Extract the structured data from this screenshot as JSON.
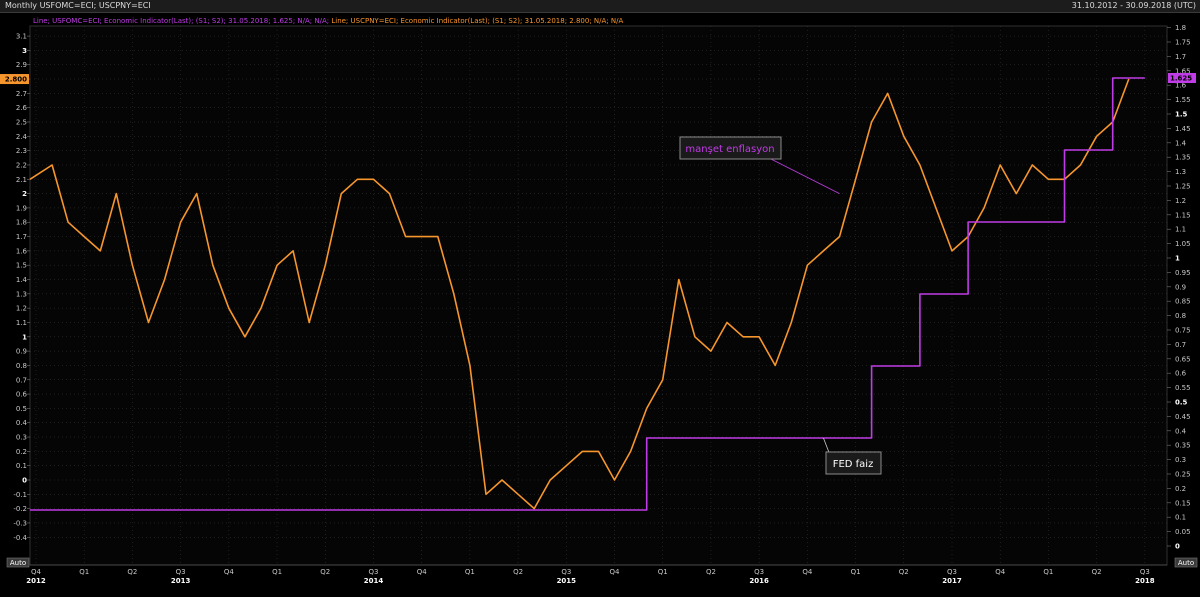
{
  "header": {
    "title": "Monthly USFOMC=ECI; USCPNY=ECI",
    "range": "31.10.2012 - 30.09.2018 (UTC)"
  },
  "legend": {
    "fed_text": "Line; USFOMC=ECI; Economic Indicator(Last); (S1; S2); 31.05.2018; 1.625; N/A; N/A",
    "cpi_text": "Line; USCPNY=ECI; Economic Indicator(Last); (S1; S2); 31.05.2018; 2.800; N/A; N/A"
  },
  "controls": {
    "auto_left": "Auto",
    "auto_right": "Auto"
  },
  "colors": {
    "background": "#000000",
    "cpi": "#f7962d",
    "fed": "#c03ce6",
    "grid": "#3a3a3a"
  },
  "chart_data": {
    "type": "line",
    "x_start": "2012-10",
    "x_end": "2018-09",
    "frequency": "monthly",
    "left_axis": {
      "ylim": [
        -0.5,
        3.2
      ],
      "ticks": [
        -0.4,
        -0.3,
        -0.2,
        -0.1,
        0,
        0.1,
        0.2,
        0.3,
        0.4,
        0.5,
        0.6,
        0.7,
        0.8,
        0.9,
        1,
        1.1,
        1.2,
        1.3,
        1.4,
        1.5,
        1.6,
        1.7,
        1.8,
        1.9,
        2,
        2.1,
        2.2,
        2.3,
        2.4,
        2.5,
        2.6,
        2.7,
        2.8,
        2.9,
        3,
        3.1
      ],
      "tick_labels": [
        "-0.4",
        "-0.3",
        "-0.2",
        "-0.1",
        "0",
        "0.1",
        "0.2",
        "0.3",
        "0.4",
        "0.5",
        "0.6",
        "0.7",
        "0.8",
        "0.9",
        "1",
        "1.1",
        "1.2",
        "1.3",
        "1.4",
        "1.5",
        "1.6",
        "1.7",
        "1.8",
        "1.9",
        "2",
        "2.1",
        "2.2",
        "2.3",
        "2.4",
        "2.5",
        "2.6",
        "2.7",
        "2.8",
        "2.9",
        "3",
        "3.1"
      ],
      "bold_labels": [
        "0",
        "1",
        "2",
        "3"
      ]
    },
    "right_axis": {
      "ylim": [
        -0.05,
        1.85
      ],
      "ticks": [
        0,
        0.05,
        0.1,
        0.15,
        0.2,
        0.25,
        0.3,
        0.35,
        0.4,
        0.45,
        0.5,
        0.55,
        0.6,
        0.65,
        0.7,
        0.75,
        0.8,
        0.85,
        0.9,
        0.95,
        1,
        1.05,
        1.1,
        1.15,
        1.2,
        1.25,
        1.3,
        1.35,
        1.4,
        1.45,
        1.5,
        1.55,
        1.6,
        1.65,
        1.7,
        1.75,
        1.8
      ],
      "tick_labels": [
        "0",
        "0.05",
        "0.1",
        "0.15",
        "0.2",
        "0.25",
        "0.3",
        "0.35",
        "0.4",
        "0.45",
        "0.5",
        "0.55",
        "0.6",
        "0.65",
        "0.7",
        "0.75",
        "0.8",
        "0.85",
        "0.9",
        "0.95",
        "1",
        "1.05",
        "1.1",
        "1.15",
        "1.2",
        "1.25",
        "1.3",
        "1.35",
        "1.4",
        "1.45",
        "1.5",
        "1.55",
        "1.6",
        "1.65",
        "1.7",
        "1.75",
        "1.8"
      ],
      "bold_labels": [
        "0",
        "0.5",
        "1",
        "1.5"
      ]
    },
    "x_axis": {
      "quarters": [
        {
          "label": "Q4",
          "date": "2012-10"
        },
        {
          "label": "Q1",
          "date": "2013-01"
        },
        {
          "label": "Q2",
          "date": "2013-04"
        },
        {
          "label": "Q3",
          "date": "2013-07"
        },
        {
          "label": "Q4",
          "date": "2013-10"
        },
        {
          "label": "Q1",
          "date": "2014-01"
        },
        {
          "label": "Q2",
          "date": "2014-04"
        },
        {
          "label": "Q3",
          "date": "2014-07"
        },
        {
          "label": "Q4",
          "date": "2014-10"
        },
        {
          "label": "Q1",
          "date": "2015-01"
        },
        {
          "label": "Q2",
          "date": "2015-04"
        },
        {
          "label": "Q3",
          "date": "2015-07"
        },
        {
          "label": "Q4",
          "date": "2015-10"
        },
        {
          "label": "Q1",
          "date": "2016-01"
        },
        {
          "label": "Q2",
          "date": "2016-04"
        },
        {
          "label": "Q3",
          "date": "2016-07"
        },
        {
          "label": "Q4",
          "date": "2016-10"
        },
        {
          "label": "Q1",
          "date": "2017-01"
        },
        {
          "label": "Q2",
          "date": "2017-04"
        },
        {
          "label": "Q3",
          "date": "2017-07"
        },
        {
          "label": "Q4",
          "date": "2017-10"
        },
        {
          "label": "Q1",
          "date": "2018-01"
        },
        {
          "label": "Q2",
          "date": "2018-04"
        },
        {
          "label": "Q3",
          "date": "2018-07"
        }
      ],
      "years": [
        {
          "label": "2012",
          "date": "2012-10"
        },
        {
          "label": "2013",
          "date": "2013-07"
        },
        {
          "label": "2014",
          "date": "2014-07"
        },
        {
          "label": "2015",
          "date": "2015-07"
        },
        {
          "label": "2016",
          "date": "2016-07"
        },
        {
          "label": "2017",
          "date": "2017-07"
        },
        {
          "label": "2018",
          "date": "2018-07"
        }
      ]
    },
    "series": [
      {
        "axis": "left",
        "color": "#f7962d",
        "start": "2012-10",
        "values": [
          2.1,
          2.2,
          1.8,
          1.7,
          1.6,
          2.0,
          1.5,
          1.1,
          1.4,
          1.8,
          2.0,
          1.5,
          1.2,
          1.0,
          1.2,
          1.5,
          1.6,
          1.1,
          1.5,
          2.0,
          2.1,
          2.1,
          2.0,
          1.7,
          1.7,
          1.7,
          1.3,
          0.8,
          -0.1,
          0.0,
          -0.1,
          -0.2,
          0.0,
          0.1,
          0.2,
          0.2,
          0.0,
          0.2,
          0.5,
          0.7,
          1.4,
          1.0,
          0.9,
          1.1,
          1.0,
          1.0,
          0.8,
          1.1,
          1.5,
          1.6,
          1.7,
          2.1,
          2.5,
          2.7,
          2.4,
          2.2,
          1.9,
          1.6,
          1.7,
          1.9,
          2.2,
          2.0,
          2.2,
          2.1,
          2.1,
          2.2,
          2.4,
          2.5,
          2.8
        ]
      },
      {
        "axis": "right",
        "color": "#c03ce6",
        "start": "2012-10",
        "values": [
          0.125,
          0.125,
          0.125,
          0.125,
          0.125,
          0.125,
          0.125,
          0.125,
          0.125,
          0.125,
          0.125,
          0.125,
          0.125,
          0.125,
          0.125,
          0.125,
          0.125,
          0.125,
          0.125,
          0.125,
          0.125,
          0.125,
          0.125,
          0.125,
          0.125,
          0.125,
          0.125,
          0.125,
          0.125,
          0.125,
          0.125,
          0.125,
          0.125,
          0.125,
          0.125,
          0.125,
          0.125,
          0.125,
          0.375,
          0.375,
          0.375,
          0.375,
          0.375,
          0.375,
          0.375,
          0.375,
          0.375,
          0.375,
          0.375,
          0.375,
          0.375,
          0.375,
          0.625,
          0.625,
          0.625,
          0.875,
          0.875,
          0.875,
          1.125,
          1.125,
          1.125,
          1.125,
          1.125,
          1.125,
          1.375,
          1.375,
          1.375,
          1.625,
          1.625,
          1.625
        ]
      }
    ],
    "last_values": {
      "left": "2.800",
      "right": "1.625"
    },
    "annotations": [
      {
        "text": "manşet enflasyon",
        "color": "#c03ce6",
        "target_date": "2016-12",
        "target_value": 2.0
      },
      {
        "text": "FED faiz",
        "color": "#ffffff",
        "target_date": "2016-11",
        "target_value": 0.375
      }
    ]
  }
}
